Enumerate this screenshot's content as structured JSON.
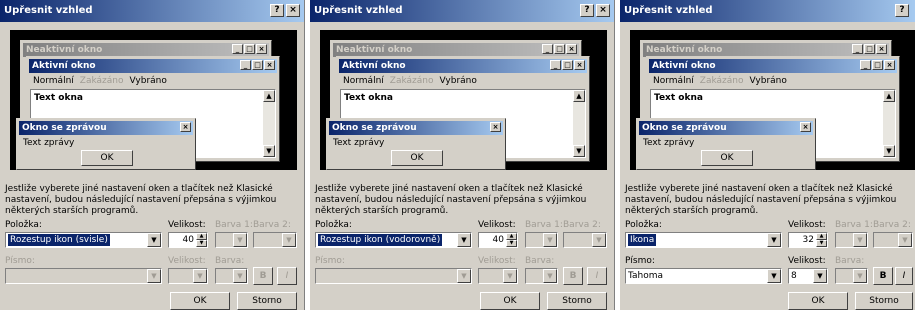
{
  "dialogs": [
    {
      "title": "Upřesnit vzhled",
      "help_label": "?",
      "close_label": "×",
      "preview": {
        "inactive_title": "Neaktivní okno",
        "active_title": "Aktivní okno",
        "menu_normal": "Normální",
        "menu_disabled": "Zakázáno",
        "menu_selected": "Vybráno",
        "window_text": "Text okna",
        "msg_title": "Okno se zprávou",
        "msg_text": "Text zprávy",
        "msg_ok": "OK"
      },
      "note": "Jestliže vyberete jiné nastavení oken a tlačítek než Klasické nastavení, budou následující nastavení přepsána s výjimkou některých starších programů.",
      "item_label": "Položka:",
      "item_value": "Rozestup ikon (svisle)",
      "size_label": "Velikost:",
      "size_value": "40",
      "color1_label": "Barva 1:",
      "color2_label": "Barva 2:",
      "font_label": "Písmo:",
      "font_value": "",
      "font_size_label": "Velikost:",
      "font_size_value": "",
      "font_color_label": "Barva:",
      "bold_label": "B",
      "italic_label": "I",
      "ok_label": "OK",
      "cancel_label": "Storno"
    },
    {
      "title": "Upřesnit vzhled",
      "help_label": "?",
      "close_label": "×",
      "preview": {
        "inactive_title": "Neaktivní okno",
        "active_title": "Aktivní okno",
        "menu_normal": "Normální",
        "menu_disabled": "Zakázáno",
        "menu_selected": "Vybráno",
        "window_text": "Text okna",
        "msg_title": "Okno se zprávou",
        "msg_text": "Text zprávy",
        "msg_ok": "OK"
      },
      "note": "Jestliže vyberete jiné nastavení oken a tlačítek než Klasické nastavení, budou následující nastavení přepsána s výjimkou některých starších programů.",
      "item_label": "Položka:",
      "item_value": "Rozestup ikon (vodorovně)",
      "size_label": "Velikost:",
      "size_value": "40",
      "color1_label": "Barva 1:",
      "color2_label": "Barva 2:",
      "font_label": "Písmo:",
      "font_value": "",
      "font_size_label": "Velikost:",
      "font_size_value": "",
      "font_color_label": "Barva:",
      "bold_label": "B",
      "italic_label": "I",
      "ok_label": "OK",
      "cancel_label": "Storno"
    },
    {
      "title": "Upřesnit vzhled",
      "help_label": "?",
      "close_label": "×",
      "preview": {
        "inactive_title": "Neaktivní okno",
        "active_title": "Aktivní okno",
        "menu_normal": "Normální",
        "menu_disabled": "Zakázáno",
        "menu_selected": "Vybráno",
        "window_text": "Text okna",
        "msg_title": "Okno se zprávou",
        "msg_text": "Text zprávy",
        "msg_ok": "OK"
      },
      "note": "Jestliže vyberete jiné nastavení oken a tlačítek než Klasické nastavení, budou následující nastavení přepsána s výjimkou některých starších programů.",
      "item_label": "Položka:",
      "item_value": "Ikona",
      "size_label": "Velikost:",
      "size_value": "32",
      "color1_label": "Barva 1:",
      "color2_label": "Barva 2:",
      "font_label": "Písmo:",
      "font_value": "Tahoma",
      "font_size_label": "Velikost:",
      "font_size_value": "8",
      "font_color_label": "Barva:",
      "bold_label": "B",
      "italic_label": "I",
      "ok_label": "OK",
      "cancel_label": "Storno"
    }
  ]
}
